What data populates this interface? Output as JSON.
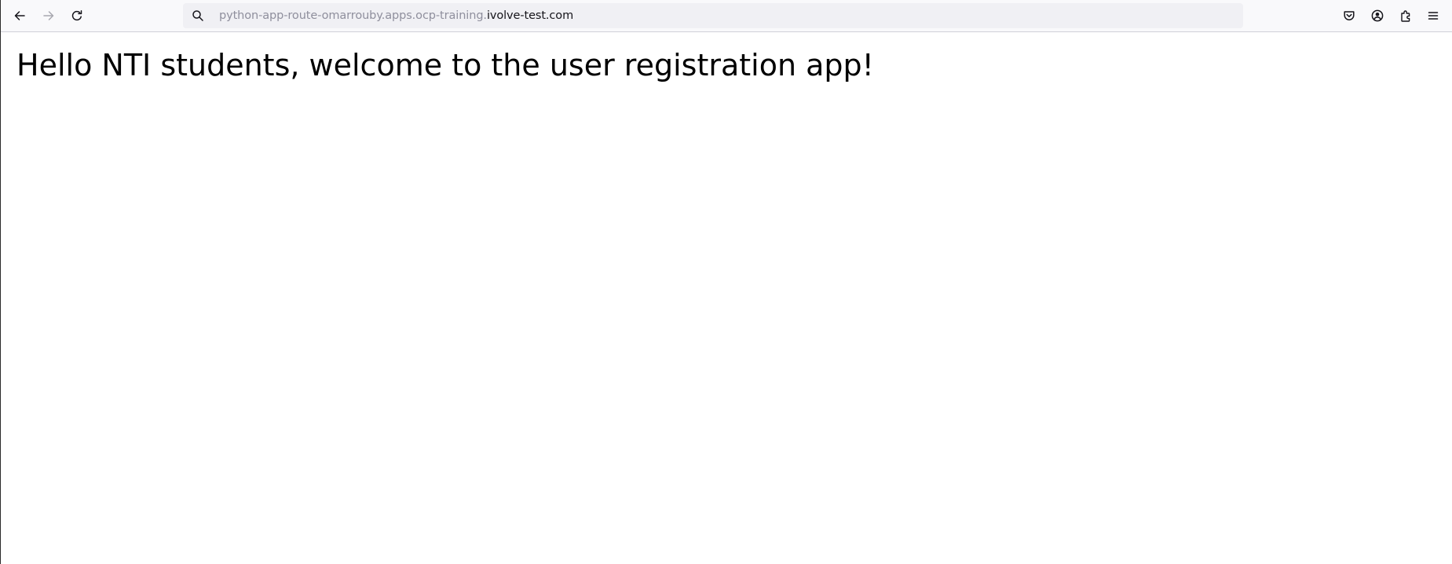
{
  "browser": {
    "toolbar": {
      "back": {
        "icon": "arrow-left-icon",
        "enabled": true
      },
      "forward": {
        "icon": "arrow-right-icon",
        "enabled": false
      },
      "reload": {
        "icon": "reload-icon"
      }
    },
    "url_bar": {
      "icon": "search-icon",
      "url_prefix": "python-app-route-omarrouby.apps.ocp-training.",
      "url_domain": "ivolve-test.com"
    },
    "right_icons": [
      "pocket-icon",
      "account-icon",
      "extensions-icon",
      "hamburger-menu-icon"
    ]
  },
  "page": {
    "heading": "Hello NTI students, welcome to the user registration app!"
  },
  "colors": {
    "toolbar_bg": "#f9f9fb",
    "urlbar_bg": "#f0f0f4",
    "url_prefix": "#8f8f9d",
    "url_domain": "#15141a",
    "icon": "#15141a",
    "icon_disabled": "#a8a8b0"
  }
}
